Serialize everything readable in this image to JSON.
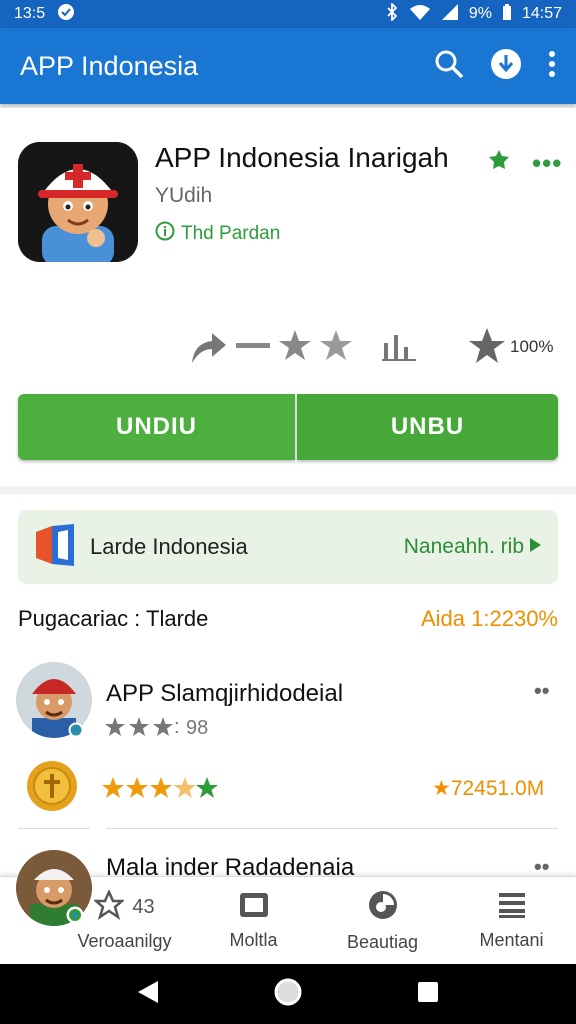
{
  "status": {
    "time": "13:5",
    "battery": "9%",
    "clock": "14:57"
  },
  "appbar": {
    "title": "APP Indonesia",
    "icons": [
      "search-icon",
      "download-icon",
      "more-vert-icon"
    ]
  },
  "app": {
    "title": "APP Indonesia Inarigah",
    "subtitle": "YUdih",
    "developer": "Thd Pardan",
    "stats_percent": "100%"
  },
  "buttons": {
    "left": "UNDIU",
    "right": "UNBU"
  },
  "banner": {
    "label": "Larde Indonesia",
    "link": "Naneahh. rib"
  },
  "section": {
    "left": "Pugacariac : Tlarde",
    "right": "Aida 1:2230%"
  },
  "items": [
    {
      "title": "APP Slamqjirhidodeial",
      "rating_text": "98"
    },
    {
      "price": "★72451.0M"
    },
    {
      "title": "Mala inder Radadenaia"
    }
  ],
  "bottom_nav": [
    {
      "label": "Veroaanilgy",
      "count": "43",
      "icon": "star-icon"
    },
    {
      "label": "Moltla",
      "icon": "tablet-icon"
    },
    {
      "label": "Beautiag",
      "icon": "pie-icon"
    },
    {
      "label": "Mentani",
      "icon": "list-icon"
    }
  ],
  "colors": {
    "primary": "#1976d2",
    "green": "#4caf3e",
    "orange": "#ef8f00"
  }
}
